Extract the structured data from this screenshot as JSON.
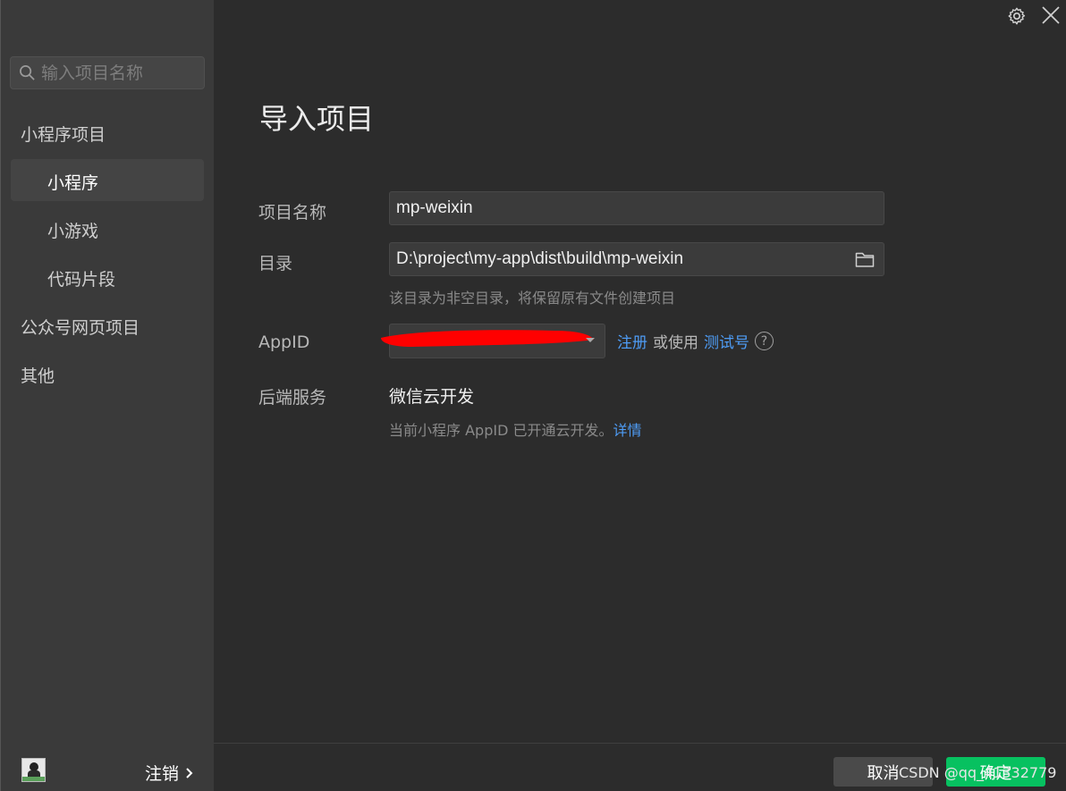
{
  "sidebar": {
    "search_placeholder": "输入项目名称",
    "categories": [
      {
        "label": "小程序项目"
      },
      {
        "label": "小程序"
      },
      {
        "label": "小游戏"
      },
      {
        "label": "代码片段"
      },
      {
        "label": "公众号网页项目"
      },
      {
        "label": "其他"
      }
    ],
    "active": "小程序",
    "logout_label": "注销"
  },
  "main": {
    "title": "导入项目",
    "project_name_label": "项目名称",
    "project_name_value": "mp-weixin",
    "directory_label": "目录",
    "directory_value": "D:\\project\\my-app\\dist\\build\\mp-weixin",
    "directory_hint": "该目录为非空目录，将保留原有文件创建项目",
    "appid_label": "AppID",
    "register_link": "注册",
    "or_use_text": "或使用",
    "test_account_link": "测试号",
    "help_glyph": "?",
    "backend_label": "后端服务",
    "backend_value": "微信云开发",
    "backend_hint": "当前小程序 AppID 已开通云开发。",
    "details_link": "详情"
  },
  "footer": {
    "cancel_label": "取消",
    "confirm_label": "确定",
    "watermark": "CSDN @qq_41332779"
  },
  "colors": {
    "accent_green": "#07c160",
    "link_blue": "#4e9cf5",
    "redaction": "#ff0000"
  },
  "icons": [
    "search-icon",
    "folder-icon",
    "gear-icon",
    "close-icon",
    "help-icon",
    "chevron-right-icon"
  ]
}
